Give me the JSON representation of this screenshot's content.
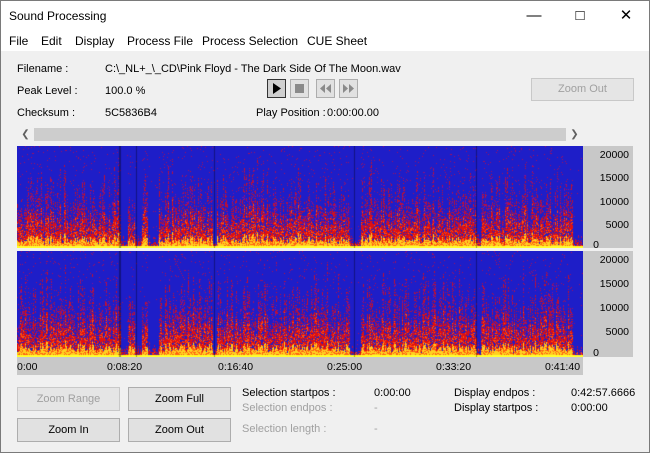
{
  "window": {
    "title": "Sound Processing"
  },
  "menu": [
    "File",
    "Edit",
    "Display",
    "Process File",
    "Process Selection",
    "CUE Sheet"
  ],
  "info": {
    "filename_label": "Filename :",
    "filename_value": "C:\\_NL+_\\_CD\\Pink Floyd - The Dark Side Of The Moon.wav",
    "peak_label": "Peak Level :",
    "peak_value": "100.0 %",
    "checksum_label": "Checksum :",
    "checksum_value": "5C5836B4",
    "play_position_label": "Play Position :",
    "play_position_value": "0:00:00.00"
  },
  "transport": [
    "play-icon",
    "stop-icon",
    "rewind-icon",
    "fast-forward-icon"
  ],
  "buttons": {
    "zoom_out_top": "Zoom Out",
    "zoom_range": "Zoom Range",
    "zoom_full": "Zoom Full",
    "zoom_in": "Zoom In",
    "zoom_out": "Zoom Out"
  },
  "freq_ticks": [
    "20000",
    "15000",
    "10000",
    "5000",
    "0"
  ],
  "time_ticks": [
    "0:00",
    "0:08:20",
    "0:16:40",
    "0:25:00",
    "0:33:20",
    "0:41:40"
  ],
  "selection": {
    "startpos_label": "Selection startpos :",
    "startpos_value": "0:00:00",
    "endpos_label": "Selection endpos :",
    "endpos_value": "-",
    "length_label": "Selection length :",
    "length_value": "-"
  },
  "display": {
    "endpos_label": "Display endpos :",
    "endpos_value": "0:42:57.6666",
    "startpos_label": "Display startpos :",
    "startpos_value": "0:00:00"
  },
  "colors": {
    "spectrogram_bg": "#1e1ec8",
    "axis_bg": "#c8c8c8",
    "accent_red": "#e01010",
    "accent_yellow": "#ffff30"
  }
}
